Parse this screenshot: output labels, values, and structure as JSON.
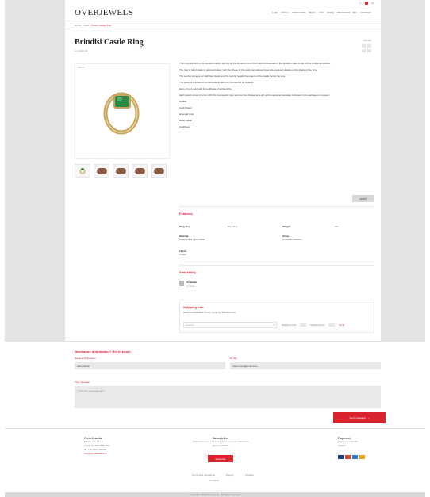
{
  "header": {
    "logo": "OVERJEWELS",
    "nav": [
      "LINK",
      "ANELLI",
      "ORECCHINI",
      "MEET",
      "LINE",
      "STATE",
      "PROGRAM",
      "IBC",
      "CONTACT"
    ],
    "top_links": [
      "IT",
      "EN"
    ],
    "breadcrumb": [
      "Home",
      "Anelli",
      "Bristol Castle Ring"
    ]
  },
  "product": {
    "title": "Brindisi Castle Ring",
    "sku": "ref. 2018-09",
    "price_label": "ITA 790",
    "image_alt": "emerald-ring",
    "zoom_label": "ZOOM",
    "thumb_count": 5,
    "description": [
      "This ring inspired by the Brindisi Castle, symbol of the city and one of the finest fortifications of the Apulian coast, is set with a central gemstone.",
      "The ring is hand made in gold and silver, with the shape of the walls reproduced by small engraved details on the shank of the ring.",
      "The central stone is set with four claws and the setting recalls the towers of the castle facing the sea.",
      "The piece is produced in small quantity and can be resized on request.",
      "Every ring is sold with its certificate of authenticity.",
      "Each jewel comes in a box with the Overjewels logo and can be shipped as a gift with a personal message included in the package on request."
    ],
    "details_label": "Details:",
    "details": [
      "Gold Plated",
      "Emerald color",
      "Hand made",
      "Certificate"
    ],
    "print_label": "PRINT"
  },
  "features": {
    "heading": "Features",
    "specs": [
      {
        "key": "Ring Size",
        "value": "0.0 x 0.0"
      },
      {
        "key": "Weight",
        "value": "5.5"
      }
    ],
    "materials_key": "Material",
    "materials_value": "Argento 925 / Oro Giallo",
    "stone_key": "Stone",
    "stone_value": "Smeraldo sintetico",
    "finish_key": "Finish",
    "finish_value": "Lucido"
  },
  "availability": {
    "heading": "Availability",
    "status": "Available",
    "sub": "in stock"
  },
  "shipping": {
    "heading": "Shipping Info",
    "sub": "Select a destination to see shipping time and cost",
    "select_placeholder": "Country",
    "opt_a": "Shipping cost",
    "opt_b": "Shipping time",
    "link": "Send"
  },
  "contact": {
    "heading": "Need more information? Get in touch",
    "name_label": "Name and Surname",
    "name_value": "Mario Rossi",
    "email_label": "E-mail",
    "email_value": "mario.rossi@email.com",
    "message_label": "Your message",
    "message_placeholder": "Type your message here...",
    "send_label": "Send message"
  },
  "footer": {
    "about_heading": "OverJewels",
    "about_lines": [
      "Piazza Vittoria 12",
      "72100 Brindisi (BR) Italy",
      "tel. +39 0831 000000",
      "info@overjewels.com"
    ],
    "newsletter_heading": "Newsletter",
    "newsletter_lines": [
      "Subscribe to receive news about our new collections",
      "and promotions"
    ],
    "subscribe_label": "Subscribe",
    "pay_heading": "Payment",
    "pay_lines": [
      "Accepted methods",
      "PayPal"
    ],
    "links": [
      "Terms and Conditions",
      "Privacy",
      "Cookies"
    ],
    "links_sub": "Contacts",
    "copyright": "Copyright 2018 OverJewels - All rights reserved"
  },
  "colors": {
    "accent": "#d9232d",
    "emerald": "#2c8a4a",
    "gold": "#c9a45c",
    "visa": "#1a3f8a",
    "mastercard": "#e04b2b",
    "amex": "#2a7ecf"
  }
}
